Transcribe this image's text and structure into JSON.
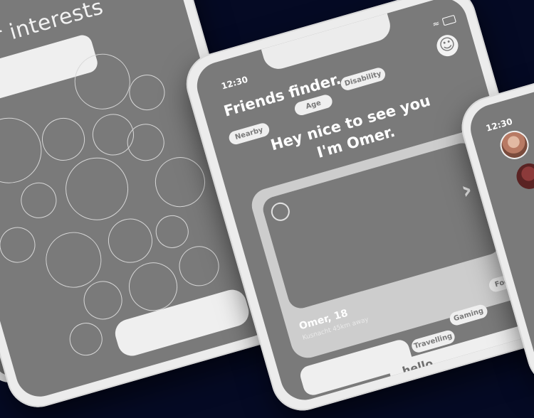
{
  "phone_left": {
    "title": "our interests",
    "bubbles_count": 17
  },
  "phone_center": {
    "time": "12:30",
    "title": "Friends finder.",
    "filters": [
      "Nearby",
      "Age",
      "Disability"
    ],
    "greeting_line1": "Hey nice to see you",
    "greeting_line2": "I'm Omer.",
    "profile_name": "Omer, 18",
    "profile_distance": "Kusnacht 45km away",
    "interests": [
      "Travelling",
      "Gaming",
      "Food"
    ],
    "message_placeholder": "hello"
  },
  "phone_right": {
    "time": "12:30"
  },
  "colors": {
    "background": "#050a24",
    "phone_frame": "#ececec",
    "screen": "#7a7a7a",
    "chip": "#efefef"
  },
  "icons": [
    "smiley-icon",
    "avatar-icon",
    "chevron-right-icon",
    "wifi-icon",
    "battery-icon"
  ]
}
